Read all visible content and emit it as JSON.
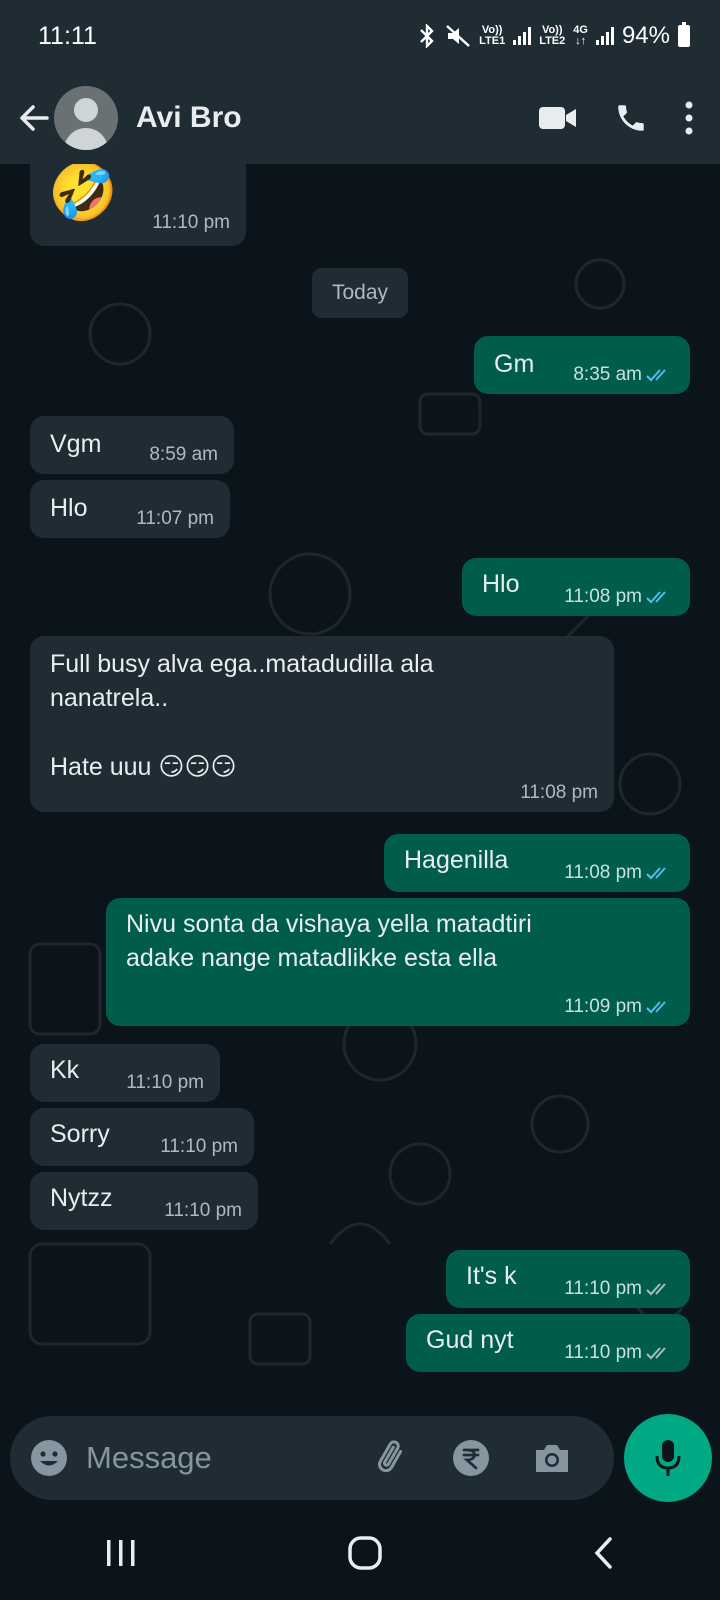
{
  "status_bar": {
    "time": "11:11",
    "sim1_label_top": "Vo))",
    "sim1_label_bottom": "LTE1",
    "sim2_label_top": "Vo))",
    "sim2_label_bottom": "LTE2",
    "network_type": "4G",
    "battery_percent": "94%"
  },
  "header": {
    "contact_name": "Avi Bro"
  },
  "date_separator": "Today",
  "messages": [
    {
      "dir": "in",
      "text": "🤣",
      "time": "11:10 pm"
    },
    {
      "dir": "out",
      "text": "Gm",
      "time": "8:35 am",
      "status": "read"
    },
    {
      "dir": "in",
      "text": "Vgm",
      "time": "8:59 am"
    },
    {
      "dir": "in",
      "text": "Hlo",
      "time": "11:07 pm"
    },
    {
      "dir": "out",
      "text": "Hlo",
      "time": "11:08 pm",
      "status": "read"
    },
    {
      "dir": "in",
      "text_lines": [
        "Full busy  alva ega..matadudilla ala",
        "nanatrela..",
        "",
        "Hate uuu 😏😏😏"
      ],
      "time": "11:08 pm"
    },
    {
      "dir": "out",
      "text": "Hagenilla",
      "time": "11:08 pm",
      "status": "read"
    },
    {
      "dir": "out",
      "text_lines": [
        "Nivu sonta da vishaya yella matadtiri",
        "adake nange matadlikke esta ella"
      ],
      "time": "11:09 pm",
      "status": "read"
    },
    {
      "dir": "in",
      "text": "Kk",
      "time": "11:10 pm"
    },
    {
      "dir": "in",
      "text": "Sorry",
      "time": "11:10 pm"
    },
    {
      "dir": "in",
      "text": "Nytzz",
      "time": "11:10 pm"
    },
    {
      "dir": "out",
      "text": "It's k",
      "time": "11:10 pm",
      "status": "delivered"
    },
    {
      "dir": "out",
      "text": "Gud nyt",
      "time": "11:10 pm",
      "status": "delivered"
    }
  ],
  "composer": {
    "placeholder": "Message"
  },
  "colors": {
    "background": "#0b141a",
    "header": "#1f2c34",
    "incoming_bubble": "#1f2c34",
    "outgoing_bubble": "#005c4b",
    "accent": "#00a884",
    "read_tick": "#53bdeb"
  }
}
